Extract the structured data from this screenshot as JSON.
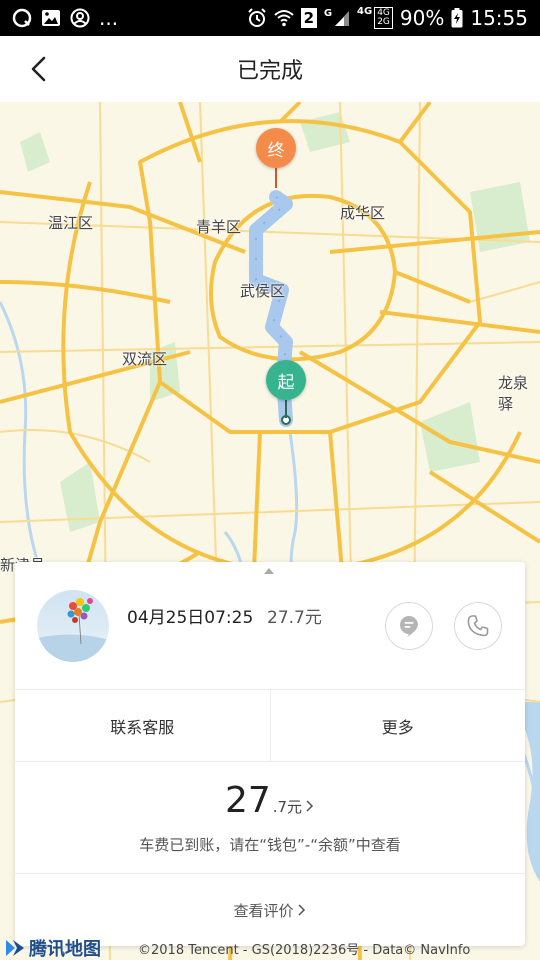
{
  "status_bar": {
    "battery": "90%",
    "time": "15:55",
    "sim_badge": "2",
    "network_g": "G",
    "network_4g": "4G",
    "network_box_top": "4G",
    "network_box_bottom": "2G",
    "overflow": "..."
  },
  "header": {
    "title": "已完成"
  },
  "map": {
    "districts": {
      "wenjiang": "温江区",
      "qingyang": "青羊区",
      "chenghua": "成华区",
      "wuhou": "武侯区",
      "shuangliu": "双流区",
      "longquan": "龙泉驿",
      "xinjin": "新津县"
    },
    "end_pin": "终",
    "start_pin": "起",
    "route_color": "#a9c8ee",
    "road_color": "#f5c244"
  },
  "trip": {
    "datetime": "04月25日07:25",
    "fare": "27.7元"
  },
  "actions": {
    "support": "联系客服",
    "more": "更多"
  },
  "fare_detail": {
    "integer": "27",
    "decimal": ".7元",
    "note": "车费已到账，请在“钱包”-“余额”中查看"
  },
  "review": {
    "label": "查看评价"
  },
  "footer": {
    "logo": "腾讯地图",
    "copyright": "©2018 Tencent - GS(2018)2236号 - Data© NavInfo"
  }
}
